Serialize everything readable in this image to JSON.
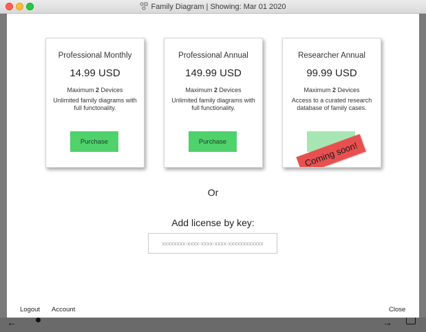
{
  "window": {
    "title": "Family Diagram | Showing: Mar 01 2020",
    "title_icon": "family-diagram-icon"
  },
  "plans": [
    {
      "name": "Professional Monthly",
      "price": "14.99 USD",
      "devices_prefix": "Maximum ",
      "devices_count": "2",
      "devices_suffix": " Devices",
      "description": "Unlimited family diagrams with full functonality.",
      "button_label": "Purchase"
    },
    {
      "name": "Professional Annual",
      "price": "149.99 USD",
      "devices_prefix": "Maximum ",
      "devices_count": "2",
      "devices_suffix": " Devices",
      "description": "Unlimited family diagrams with full functionality.",
      "button_label": "Purchase"
    },
    {
      "name": "Researcher Annual",
      "price": "99.99 USD",
      "devices_prefix": "Maximum ",
      "devices_count": "2",
      "devices_suffix": " Devices",
      "description": "Access to a curated research database of family cases.",
      "button_label": "",
      "banner": "Coming soon!"
    }
  ],
  "or_label": "Or",
  "license": {
    "label": "Add license by key:",
    "placeholder": "xxxxxxxx-xxxx-xxxx-xxxx-xxxxxxxxxxxx",
    "value": ""
  },
  "footer": {
    "logout": "Logout",
    "account": "Account",
    "close": "Close"
  },
  "colors": {
    "purchase": "#4fd16b",
    "purchase_disabled": "#a7e6b3",
    "banner": "#e8504f"
  }
}
